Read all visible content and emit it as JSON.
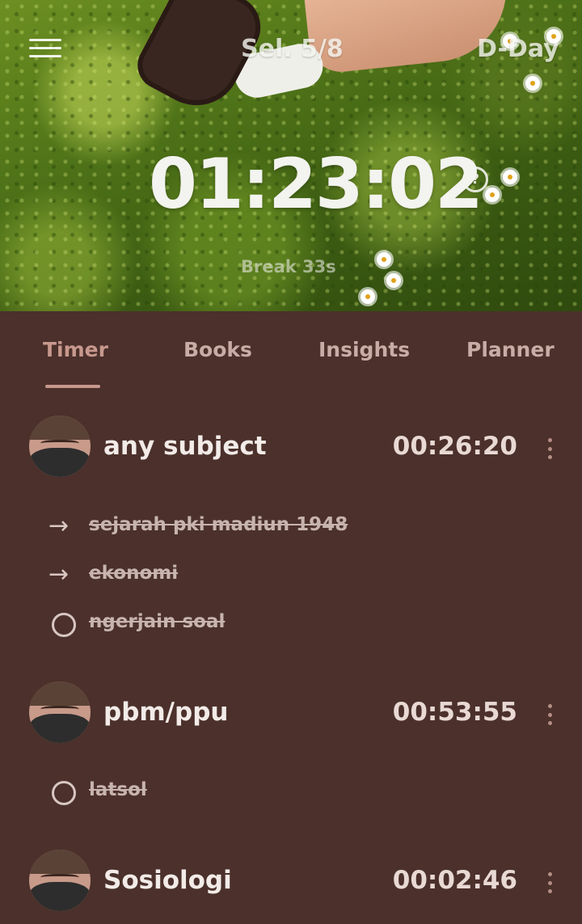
{
  "header": {
    "session_label": "Sel. 5/8",
    "dday_label": "D-Day",
    "timer": "01:23:02",
    "help_glyph": "?",
    "break_label": "Break 33s"
  },
  "tabs": [
    {
      "label": "Timer",
      "active": true
    },
    {
      "label": "Books",
      "active": false
    },
    {
      "label": "Insights",
      "active": false
    },
    {
      "label": "Planner",
      "active": false
    }
  ],
  "subjects": [
    {
      "name": "any subject",
      "time": "00:26:20",
      "tasks": [
        {
          "label": "sejarah pki madiun 1948",
          "marker": "arrow",
          "done": true
        },
        {
          "label": "ekonomi",
          "marker": "arrow",
          "done": true
        },
        {
          "label": "ngerjain soal",
          "marker": "circle",
          "done": true
        }
      ]
    },
    {
      "name": "pbm/ppu",
      "time": "00:53:55",
      "tasks": [
        {
          "label": "latsol",
          "marker": "circle",
          "done": true
        }
      ]
    },
    {
      "name": "Sosiologi",
      "time": "00:02:46",
      "tasks": []
    }
  ],
  "icons": {
    "menu": "hamburger-menu-icon",
    "help": "help-circle-icon",
    "more": "more-vertical-icon",
    "arrow": "arrow-right-icon",
    "circle": "circle-outline-icon"
  },
  "colors": {
    "background": "#4b302b",
    "active_tab": "#c7988d",
    "text": "#f2ebe8"
  }
}
